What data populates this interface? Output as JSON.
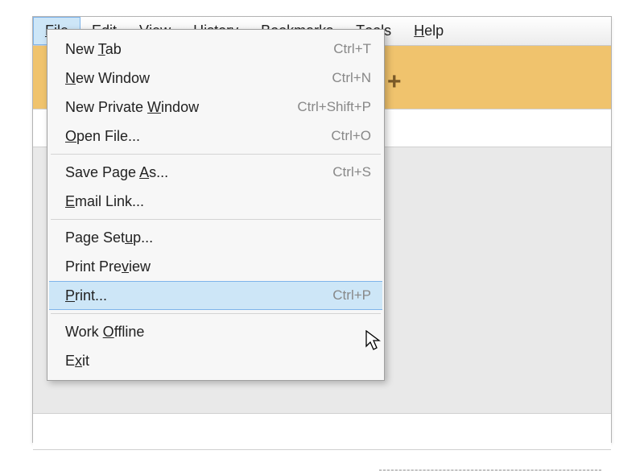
{
  "menubar": [
    {
      "pre": "",
      "u": "F",
      "post": "ile",
      "active": true
    },
    {
      "pre": "",
      "u": "E",
      "post": "dit",
      "active": false
    },
    {
      "pre": "",
      "u": "V",
      "post": "iew",
      "active": false
    },
    {
      "pre": "Hi",
      "u": "s",
      "post": "tory",
      "active": false
    },
    {
      "pre": "",
      "u": "B",
      "post": "ookmarks",
      "active": false
    },
    {
      "pre": "",
      "u": "T",
      "post": "ools",
      "active": false
    },
    {
      "pre": "",
      "u": "H",
      "post": "elp",
      "active": false
    }
  ],
  "dropdown": {
    "groups": [
      [
        {
          "pre": "New ",
          "u": "T",
          "post": "ab",
          "shortcut": "Ctrl+T",
          "highlight": false
        },
        {
          "pre": "",
          "u": "N",
          "post": "ew Window",
          "shortcut": "Ctrl+N",
          "highlight": false
        },
        {
          "pre": "New Private ",
          "u": "W",
          "post": "indow",
          "shortcut": "Ctrl+Shift+P",
          "highlight": false
        },
        {
          "pre": "",
          "u": "O",
          "post": "pen File...",
          "shortcut": "Ctrl+O",
          "highlight": false
        }
      ],
      [
        {
          "pre": "Save Page ",
          "u": "A",
          "post": "s...",
          "shortcut": "Ctrl+S",
          "highlight": false
        },
        {
          "pre": "",
          "u": "E",
          "post": "mail Link...",
          "shortcut": "",
          "highlight": false
        }
      ],
      [
        {
          "pre": "Page Set",
          "u": "u",
          "post": "p...",
          "shortcut": "",
          "highlight": false
        },
        {
          "pre": "Print Pre",
          "u": "v",
          "post": "iew",
          "shortcut": "",
          "highlight": false
        },
        {
          "pre": "",
          "u": "P",
          "post": "rint...",
          "shortcut": "Ctrl+P",
          "highlight": true
        }
      ],
      [
        {
          "pre": "Work ",
          "u": "O",
          "post": "ffline",
          "shortcut": "",
          "highlight": false
        },
        {
          "pre": "E",
          "u": "x",
          "post": "it",
          "shortcut": "",
          "highlight": false
        }
      ]
    ]
  },
  "plus_glyph": "+"
}
